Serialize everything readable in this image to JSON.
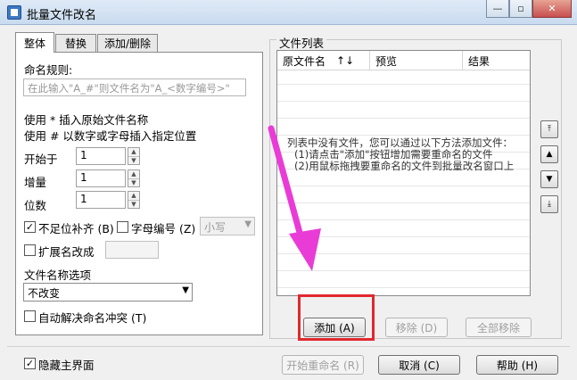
{
  "window": {
    "title": "批量文件改名",
    "minimize": "—",
    "maximize": "▫",
    "close": "✕"
  },
  "tabs": [
    {
      "label": "整体"
    },
    {
      "label": "替换"
    },
    {
      "label": "添加/删除"
    }
  ],
  "rules": {
    "label": "命名规则:",
    "placeholder": "在此输入\"A_#\"则文件名为\"A_<数字编号>\"",
    "hint1": "使用 * 插入原始文件名称",
    "hint2": "使用 # 以数字或字母插入指定位置"
  },
  "fields": {
    "start_label": "开始于",
    "start_value": "1",
    "step_label": "增量",
    "step_value": "1",
    "digits_label": "位数",
    "digits_value": "1"
  },
  "options": {
    "pad_label": "不足位补齐 (B)",
    "pad_checked": true,
    "letter_label": "字母编号 (Z)",
    "letter_checked": false,
    "case_value": "小写",
    "ext_label": "扩展名改成",
    "ext_checked": false,
    "filename_opt_label": "文件名称选项",
    "filename_opt_value": "不改变",
    "conflict_label": "自动解决命名冲突 (T)",
    "conflict_checked": false
  },
  "filelist": {
    "title": "文件列表",
    "col_original": "原文件名",
    "sort_icon": "↑↓",
    "col_preview": "预览",
    "col_result": "结果",
    "empty_line1": "列表中没有文件，您可以通过以下方法添加文件：",
    "empty_line2": "(1)请点击\"添加\"按钮增加需要重命名的文件",
    "empty_line3": "(2)用鼠标拖拽要重命名的文件到批量改名窗口上",
    "add_button": "添加 (A)",
    "remove_button": "移除 (D)",
    "remove_all_button": "全部移除"
  },
  "side_icons": [
    "move-top-icon",
    "move-up-icon",
    "move-down-icon",
    "move-bottom-icon"
  ],
  "footer": {
    "hide_main_label": "隐藏主界面",
    "hide_main_checked": true,
    "start_rename": "开始重命名 (R)",
    "cancel": "取消 (C)",
    "help": "帮助 (H)"
  },
  "colors": {
    "highlight": "#e0282f",
    "arrow": "#e93cd6"
  }
}
